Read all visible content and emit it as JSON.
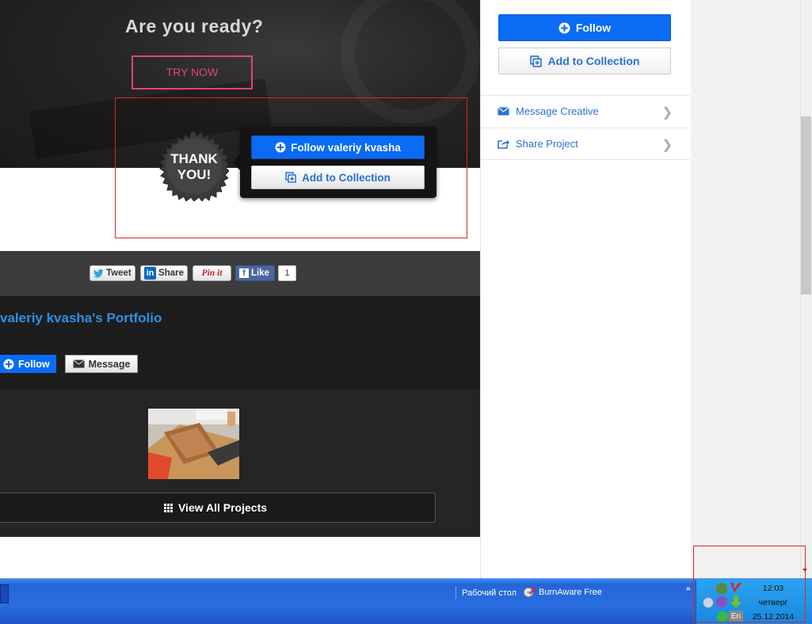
{
  "hero": {
    "title": "Are you ready?",
    "cta": "TRY NOW"
  },
  "badge": {
    "line1": "THANK",
    "line2": "YOU!"
  },
  "popup": {
    "follow_label": "Follow valeriy kvasha",
    "collection_label": "Add to Collection"
  },
  "share": {
    "tweet": "Tweet",
    "linkedin": "Share",
    "pinterest": "Pin it",
    "facebook": "Like",
    "facebook_count": "1"
  },
  "portfolio": {
    "title": "valeriy kvasha's Portfolio",
    "follow": "Follow",
    "message": "Message",
    "view_all": "View All Projects"
  },
  "sidebar": {
    "follow": "Follow",
    "collection": "Add to Collection",
    "rows": [
      {
        "label": "Message Creative"
      },
      {
        "label": "Share Project"
      }
    ]
  },
  "taskbar": {
    "items": [
      {
        "label": "Рабочий стол"
      },
      {
        "label": "BurnAware Free"
      }
    ],
    "chevron": "»",
    "lang": "En",
    "clock": {
      "time": "12:03",
      "day": "четверг",
      "date": "25.12.2014"
    }
  },
  "colors": {
    "accent": "#0a6bf5",
    "link": "#2a6fd6",
    "cta": "#e0457b",
    "highlight": "#d42a2a"
  }
}
